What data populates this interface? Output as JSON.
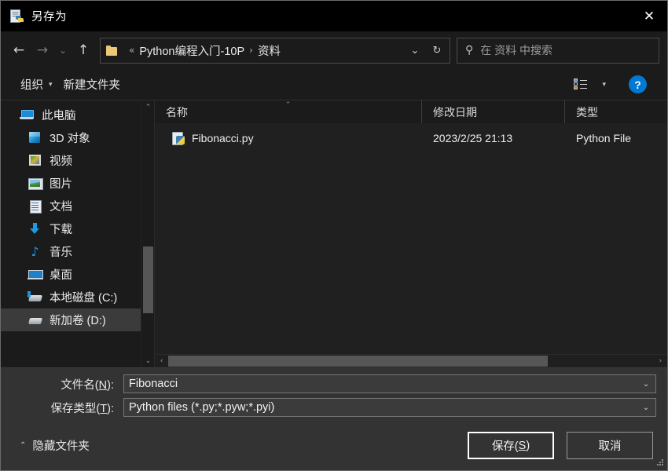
{
  "window": {
    "title": "另存为",
    "title_icon": "python-file-icon",
    "close_label": "✕"
  },
  "nav": {
    "back": "←",
    "forward": "→",
    "recent": "⌄",
    "up": "↑",
    "refresh": "↻",
    "history_caret": "⌄"
  },
  "breadcrumb": {
    "folder_icon": "folder-icon",
    "overflow": "«",
    "separator": "›",
    "segments": [
      {
        "label": "Python编程入门-10P"
      },
      {
        "label": "资料"
      }
    ]
  },
  "search": {
    "icon": "search-icon",
    "placeholder": "在 资料 中搜索",
    "value": ""
  },
  "commandbar": {
    "organize_label": "组织",
    "organize_caret": "▾",
    "new_folder_label": "新建文件夹",
    "view_icon": "list-view-icon",
    "view_caret": "▾",
    "help_label": "?"
  },
  "sidebar": {
    "scroll_up": "⌃",
    "scroll_down": "⌄",
    "items": [
      {
        "label": "此电脑",
        "icon": "this-pc-icon",
        "root": true,
        "selected": false
      },
      {
        "label": "3D 对象",
        "icon": "3d-objects-icon",
        "root": false,
        "selected": false
      },
      {
        "label": "视频",
        "icon": "videos-icon",
        "root": false,
        "selected": false
      },
      {
        "label": "图片",
        "icon": "pictures-icon",
        "root": false,
        "selected": false
      },
      {
        "label": "文档",
        "icon": "documents-icon",
        "root": false,
        "selected": false
      },
      {
        "label": "下载",
        "icon": "downloads-icon",
        "root": false,
        "selected": false
      },
      {
        "label": "音乐",
        "icon": "music-icon",
        "root": false,
        "selected": false
      },
      {
        "label": "桌面",
        "icon": "desktop-icon",
        "root": false,
        "selected": false
      },
      {
        "label": "本地磁盘 (C:)",
        "icon": "local-disk-icon",
        "root": false,
        "selected": false
      },
      {
        "label": "新加卷 (D:)",
        "icon": "hard-drive-icon",
        "root": false,
        "selected": true
      }
    ]
  },
  "filelist": {
    "columns": [
      {
        "key": "name",
        "label": "名称",
        "sorted": true,
        "sort_caret": "⌃"
      },
      {
        "key": "date",
        "label": "修改日期",
        "sorted": false,
        "sort_caret": ""
      },
      {
        "key": "type",
        "label": "类型",
        "sorted": false,
        "sort_caret": ""
      }
    ],
    "rows": [
      {
        "name": "Fibonacci.py",
        "date": "2023/2/25 21:13",
        "type": "Python File",
        "icon": "python-file-icon"
      }
    ],
    "hscroll": {
      "left_arrow": "‹",
      "right_arrow": "›"
    }
  },
  "form": {
    "filename": {
      "label_prefix": "文件名(",
      "label_key": "N",
      "label_suffix": "):",
      "value": "Fibonacci",
      "caret": "⌄"
    },
    "filetype": {
      "label_prefix": "保存类型(",
      "label_key": "T",
      "label_suffix": "):",
      "value": "Python files (*.py;*.pyw;*.pyi)",
      "caret": "⌄"
    }
  },
  "footer": {
    "hide_folders_caret": "⌃",
    "hide_folders_label": "隐藏文件夹",
    "save_prefix": "保存(",
    "save_key": "S",
    "save_suffix": ")",
    "cancel_label": "取消"
  },
  "colors": {
    "accent": "#0078d4",
    "titlebar_bg": "#000000",
    "chrome_bg": "#1b1b1b",
    "list_bg": "#202020",
    "footer_bg": "#333333",
    "folder_yellow": "#edc974",
    "selection_gray": "#3b3b3b"
  }
}
